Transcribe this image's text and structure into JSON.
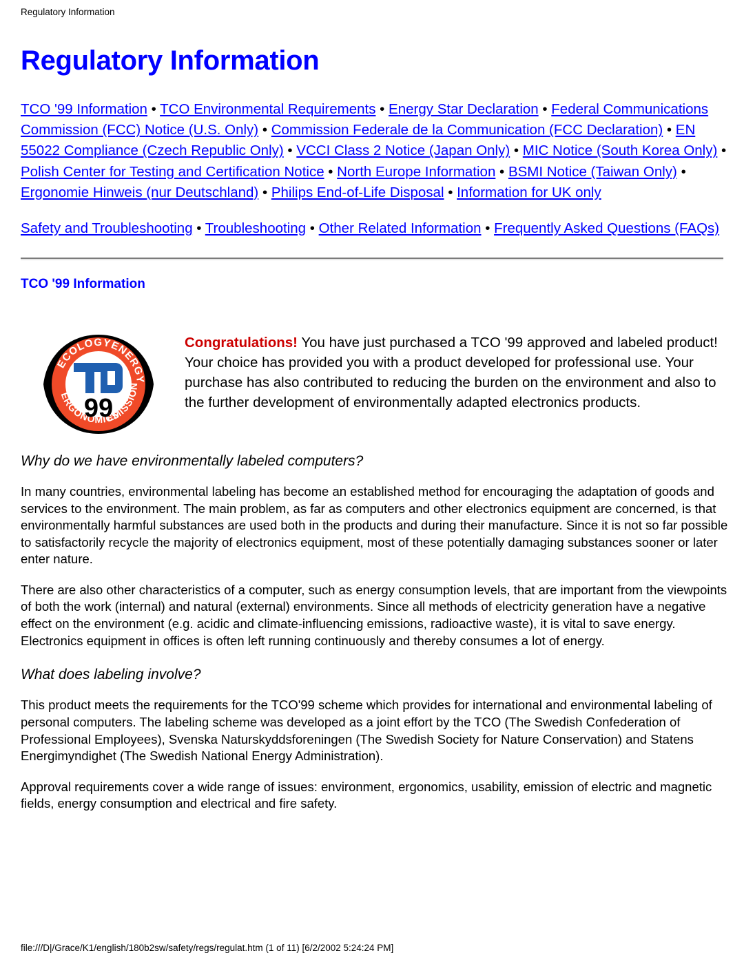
{
  "running_head": "Regulatory Information",
  "page_title": "Regulatory Information",
  "link_paragraphs": [
    {
      "links": [
        "TCO '99 Information",
        "TCO Environmental Requirements",
        "Energy Star Declaration",
        "Federal Communications Commission (FCC) Notice (U.S. Only)",
        "Commission Federale de la Communication (FCC Declaration)",
        "EN 55022 Compliance (Czech Republic Only)",
        "VCCI Class 2 Notice (Japan Only)",
        "MIC Notice (South Korea Only)",
        "Polish Center for Testing and Certification Notice",
        "North Europe Information",
        "BSMI Notice (Taiwan Only)",
        "Ergonomie Hinweis (nur Deutschland)",
        "Philips End-of-Life Disposal",
        "Information for UK only"
      ]
    },
    {
      "links": [
        "Safety and Troubleshooting",
        "Troubleshooting",
        "Other Related Information",
        "Frequently Asked Questions (FAQs)"
      ]
    }
  ],
  "link_separator": "•",
  "section_title": "TCO '99 Information",
  "logo": {
    "name": "tco-99-certification-logo",
    "center_text": "TCO",
    "year_text": "99",
    "ring_words": [
      "ECOLOGY",
      "ENERGY",
      "ERGONOMICS",
      "EMISSIONS"
    ],
    "ring_color": "#f04a28",
    "tco_color": "#1f5fb0",
    "outer_color": "#000000"
  },
  "congratulations": {
    "lead": "Congratulations!",
    "rest": " You have just purchased a TCO '99 approved and labeled product! Your choice has provided you with a product developed for professional use. Your purchase has also contributed to reducing the burden on the environment and also to the further development of environmentally adapted electronics products."
  },
  "subsections": [
    {
      "heading": "Why do we have environmentally labeled computers?",
      "paragraphs": [
        "In many countries, environmental labeling has become an established method for encouraging the adaptation of goods and services to the environment. The main problem, as far as computers and other electronics equipment are concerned, is that environmentally harmful substances are used both in the products and during their manufacture. Since it is not so far possible to satisfactorily recycle the majority of electronics equipment, most of these potentially damaging substances sooner or later enter nature.",
        "There are also other characteristics of a computer, such as energy consumption levels, that are important from the viewpoints of both the work (internal) and natural (external) environments. Since all methods of electricity generation have a negative effect on the environment (e.g. acidic and climate-influencing emissions, radioactive waste), it is vital to save energy. Electronics equipment in offices is often left running continuously and thereby consumes a lot of energy."
      ]
    },
    {
      "heading": "What does labeling involve?",
      "paragraphs": [
        "This product meets the requirements for the TCO'99 scheme which provides for international and environmental labeling of personal computers. The labeling scheme was developed as a joint effort by the TCO (The Swedish Confederation of Professional Employees), Svenska Naturskyddsforeningen (The Swedish Society for Nature Conservation) and Statens Energimyndighet (The Swedish National Energy Administration).",
        "Approval requirements cover a wide range of issues: environment, ergonomics, usability, emission of electric and magnetic fields, energy consumption and electrical and fire safety."
      ]
    }
  ],
  "footer": "file:///D|/Grace/K1/english/180b2sw/safety/regs/regulat.htm (1 of 11) [6/2/2002 5:24:24 PM]",
  "colors": {
    "link": "#0000ff",
    "heading": "#0000ff",
    "congrats": "#cc0000",
    "text": "#000000"
  }
}
